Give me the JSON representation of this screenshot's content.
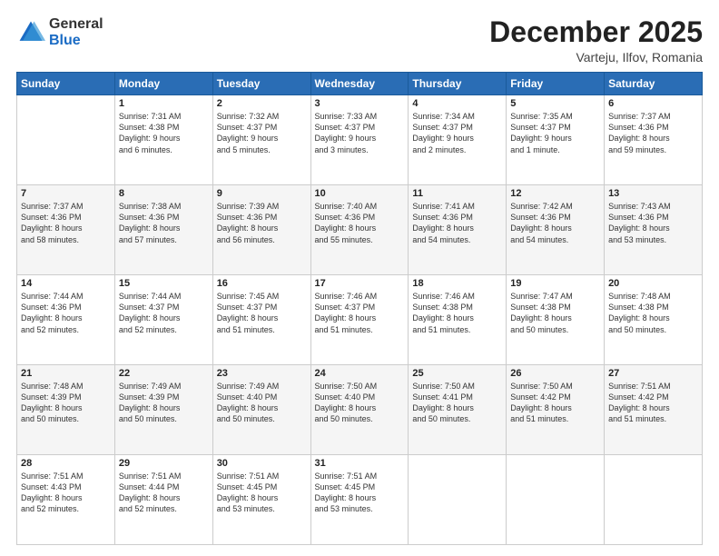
{
  "logo": {
    "general": "General",
    "blue": "Blue"
  },
  "header": {
    "title": "December 2025",
    "subtitle": "Varteju, Ilfov, Romania"
  },
  "weekdays": [
    "Sunday",
    "Monday",
    "Tuesday",
    "Wednesday",
    "Thursday",
    "Friday",
    "Saturday"
  ],
  "weeks": [
    [
      {
        "day": "",
        "info": ""
      },
      {
        "day": "1",
        "info": "Sunrise: 7:31 AM\nSunset: 4:38 PM\nDaylight: 9 hours\nand 6 minutes."
      },
      {
        "day": "2",
        "info": "Sunrise: 7:32 AM\nSunset: 4:37 PM\nDaylight: 9 hours\nand 5 minutes."
      },
      {
        "day": "3",
        "info": "Sunrise: 7:33 AM\nSunset: 4:37 PM\nDaylight: 9 hours\nand 3 minutes."
      },
      {
        "day": "4",
        "info": "Sunrise: 7:34 AM\nSunset: 4:37 PM\nDaylight: 9 hours\nand 2 minutes."
      },
      {
        "day": "5",
        "info": "Sunrise: 7:35 AM\nSunset: 4:37 PM\nDaylight: 9 hours\nand 1 minute."
      },
      {
        "day": "6",
        "info": "Sunrise: 7:37 AM\nSunset: 4:36 PM\nDaylight: 8 hours\nand 59 minutes."
      }
    ],
    [
      {
        "day": "7",
        "info": "Sunrise: 7:37 AM\nSunset: 4:36 PM\nDaylight: 8 hours\nand 58 minutes."
      },
      {
        "day": "8",
        "info": "Sunrise: 7:38 AM\nSunset: 4:36 PM\nDaylight: 8 hours\nand 57 minutes."
      },
      {
        "day": "9",
        "info": "Sunrise: 7:39 AM\nSunset: 4:36 PM\nDaylight: 8 hours\nand 56 minutes."
      },
      {
        "day": "10",
        "info": "Sunrise: 7:40 AM\nSunset: 4:36 PM\nDaylight: 8 hours\nand 55 minutes."
      },
      {
        "day": "11",
        "info": "Sunrise: 7:41 AM\nSunset: 4:36 PM\nDaylight: 8 hours\nand 54 minutes."
      },
      {
        "day": "12",
        "info": "Sunrise: 7:42 AM\nSunset: 4:36 PM\nDaylight: 8 hours\nand 54 minutes."
      },
      {
        "day": "13",
        "info": "Sunrise: 7:43 AM\nSunset: 4:36 PM\nDaylight: 8 hours\nand 53 minutes."
      }
    ],
    [
      {
        "day": "14",
        "info": "Sunrise: 7:44 AM\nSunset: 4:36 PM\nDaylight: 8 hours\nand 52 minutes."
      },
      {
        "day": "15",
        "info": "Sunrise: 7:44 AM\nSunset: 4:37 PM\nDaylight: 8 hours\nand 52 minutes."
      },
      {
        "day": "16",
        "info": "Sunrise: 7:45 AM\nSunset: 4:37 PM\nDaylight: 8 hours\nand 51 minutes."
      },
      {
        "day": "17",
        "info": "Sunrise: 7:46 AM\nSunset: 4:37 PM\nDaylight: 8 hours\nand 51 minutes."
      },
      {
        "day": "18",
        "info": "Sunrise: 7:46 AM\nSunset: 4:38 PM\nDaylight: 8 hours\nand 51 minutes."
      },
      {
        "day": "19",
        "info": "Sunrise: 7:47 AM\nSunset: 4:38 PM\nDaylight: 8 hours\nand 50 minutes."
      },
      {
        "day": "20",
        "info": "Sunrise: 7:48 AM\nSunset: 4:38 PM\nDaylight: 8 hours\nand 50 minutes."
      }
    ],
    [
      {
        "day": "21",
        "info": "Sunrise: 7:48 AM\nSunset: 4:39 PM\nDaylight: 8 hours\nand 50 minutes."
      },
      {
        "day": "22",
        "info": "Sunrise: 7:49 AM\nSunset: 4:39 PM\nDaylight: 8 hours\nand 50 minutes."
      },
      {
        "day": "23",
        "info": "Sunrise: 7:49 AM\nSunset: 4:40 PM\nDaylight: 8 hours\nand 50 minutes."
      },
      {
        "day": "24",
        "info": "Sunrise: 7:50 AM\nSunset: 4:40 PM\nDaylight: 8 hours\nand 50 minutes."
      },
      {
        "day": "25",
        "info": "Sunrise: 7:50 AM\nSunset: 4:41 PM\nDaylight: 8 hours\nand 50 minutes."
      },
      {
        "day": "26",
        "info": "Sunrise: 7:50 AM\nSunset: 4:42 PM\nDaylight: 8 hours\nand 51 minutes."
      },
      {
        "day": "27",
        "info": "Sunrise: 7:51 AM\nSunset: 4:42 PM\nDaylight: 8 hours\nand 51 minutes."
      }
    ],
    [
      {
        "day": "28",
        "info": "Sunrise: 7:51 AM\nSunset: 4:43 PM\nDaylight: 8 hours\nand 52 minutes."
      },
      {
        "day": "29",
        "info": "Sunrise: 7:51 AM\nSunset: 4:44 PM\nDaylight: 8 hours\nand 52 minutes."
      },
      {
        "day": "30",
        "info": "Sunrise: 7:51 AM\nSunset: 4:45 PM\nDaylight: 8 hours\nand 53 minutes."
      },
      {
        "day": "31",
        "info": "Sunrise: 7:51 AM\nSunset: 4:45 PM\nDaylight: 8 hours\nand 53 minutes."
      },
      {
        "day": "",
        "info": ""
      },
      {
        "day": "",
        "info": ""
      },
      {
        "day": "",
        "info": ""
      }
    ]
  ]
}
